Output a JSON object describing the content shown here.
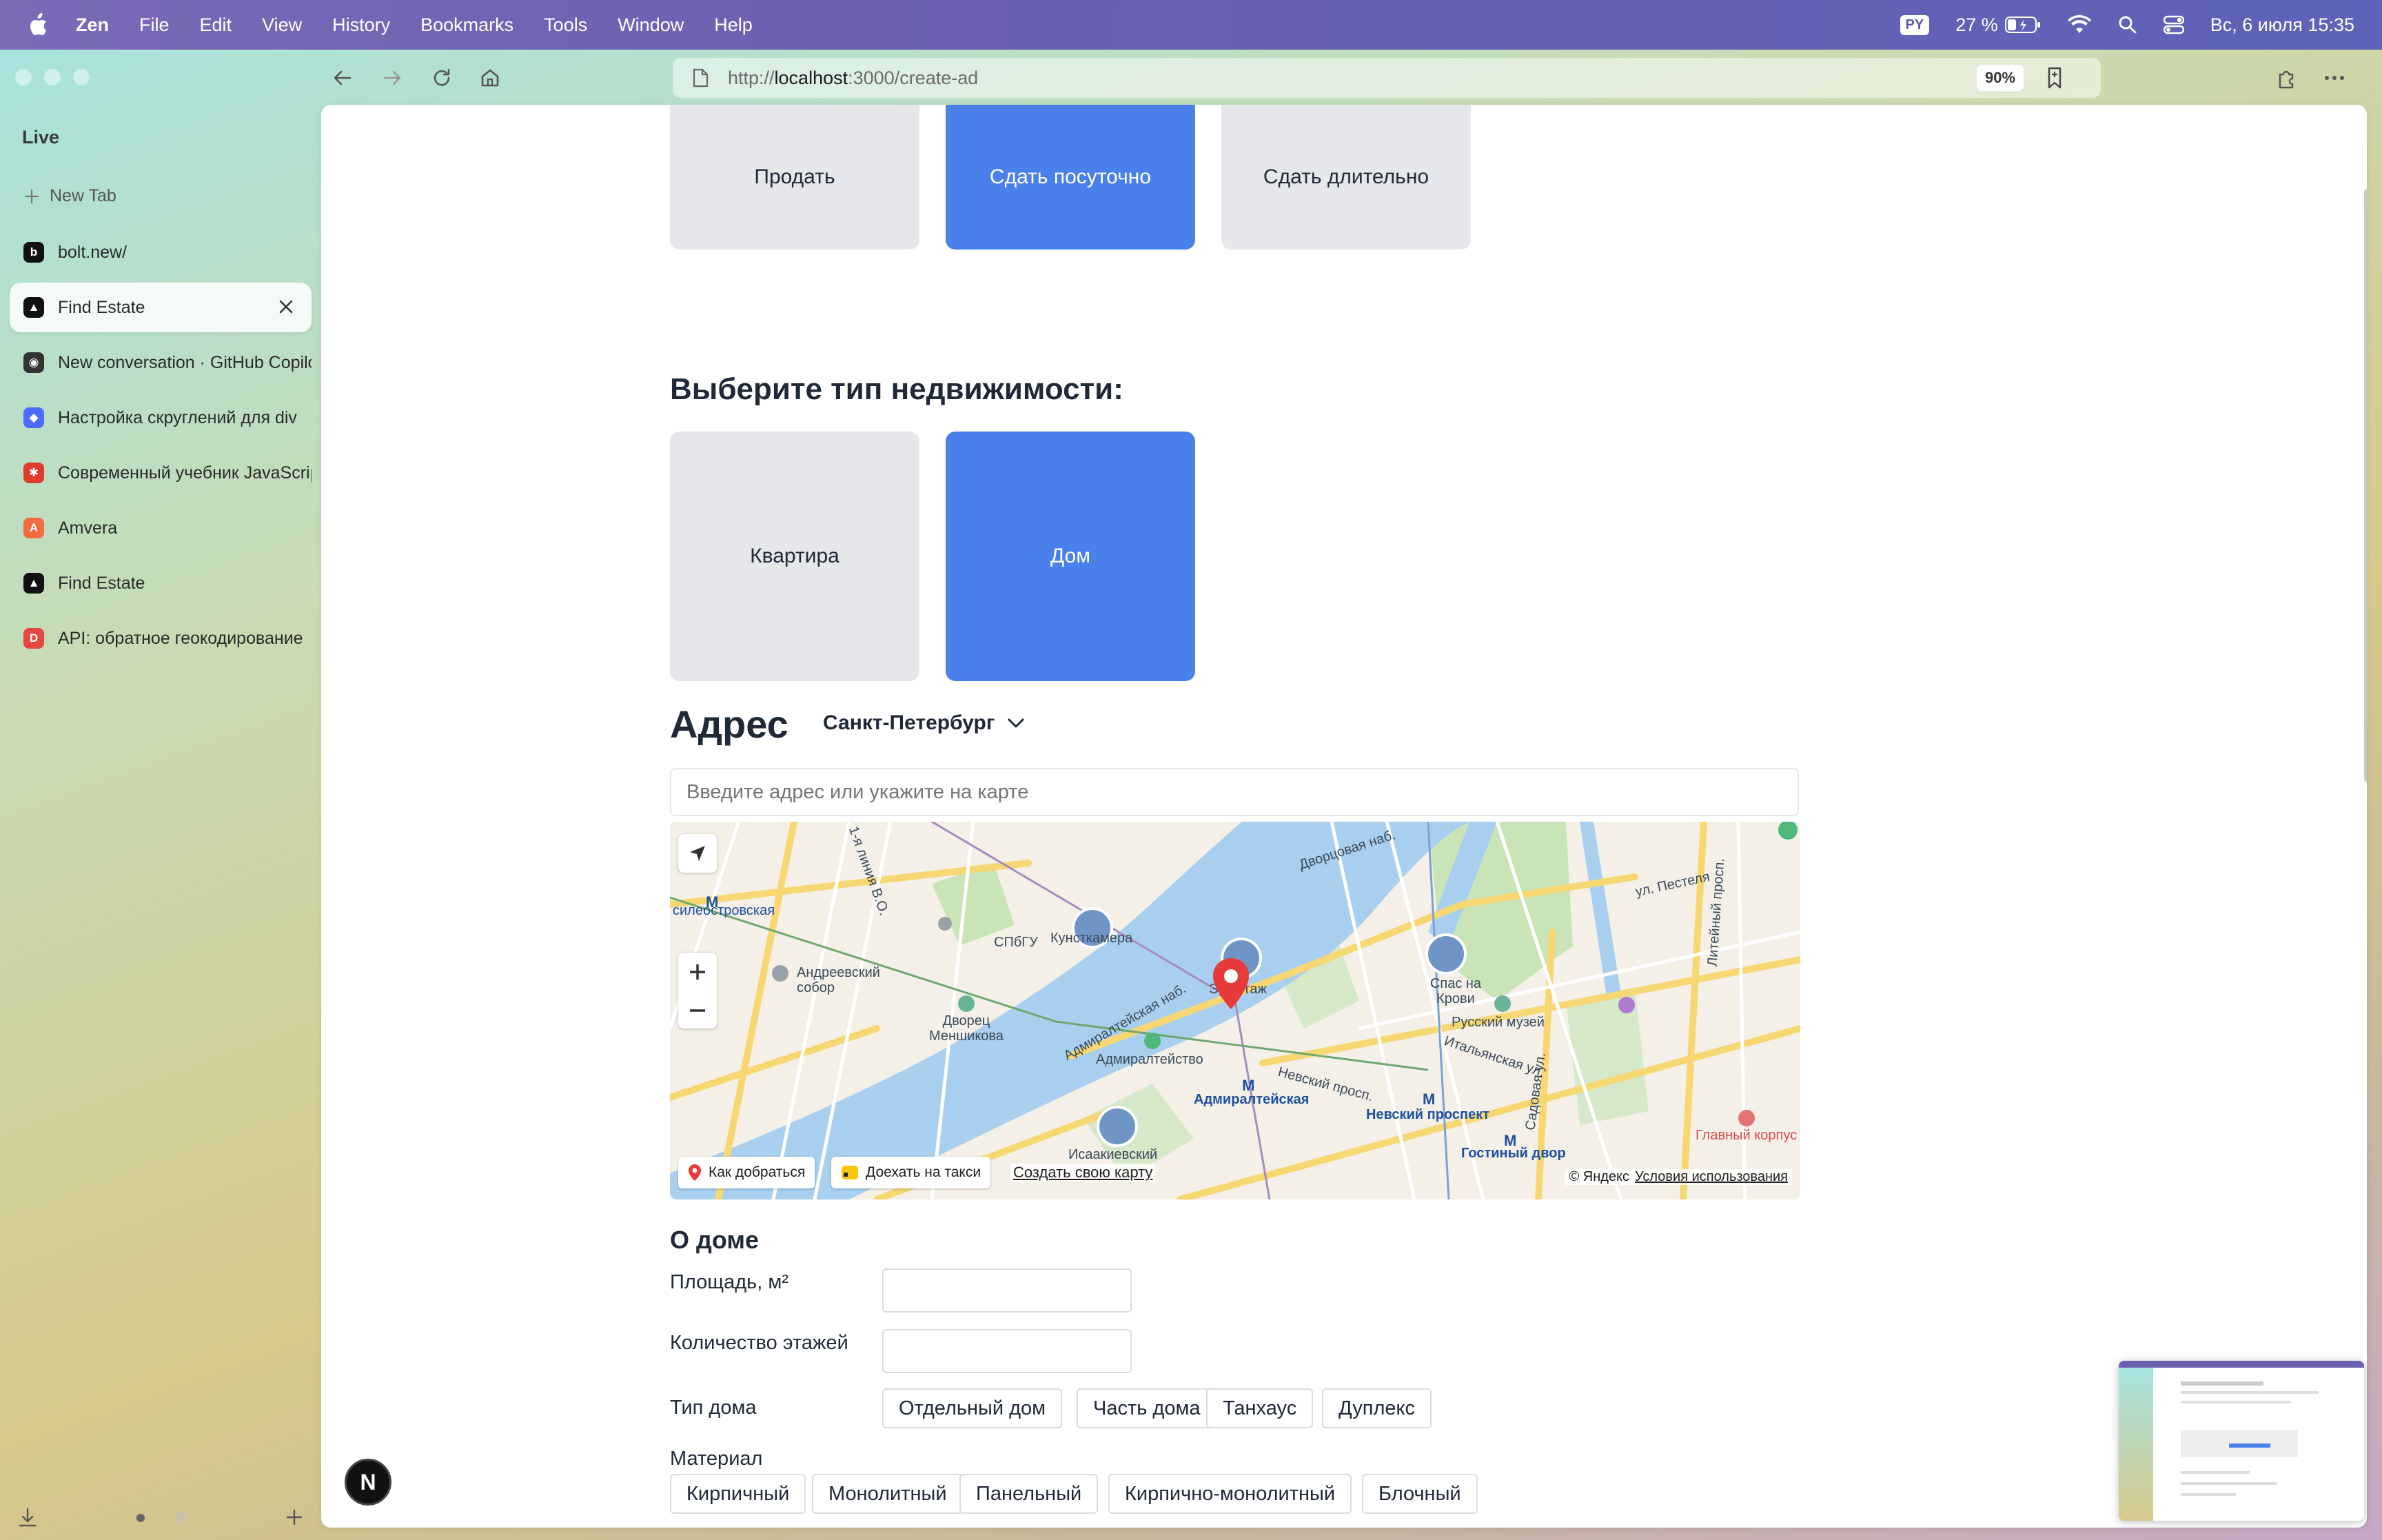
{
  "menubar": {
    "app": "Zen",
    "items": [
      "File",
      "Edit",
      "View",
      "History",
      "Bookmarks",
      "Tools",
      "Window",
      "Help"
    ],
    "lang": "PY",
    "battery": "27 %",
    "datetime": "Вс, 6 июля  15:35"
  },
  "sidebar": {
    "section": "Live",
    "new_tab": "New Tab",
    "tabs": [
      {
        "title": "bolt.new/",
        "icon": "bolt-icon",
        "color": "#111111",
        "glyph": "b"
      },
      {
        "title": "Find Estate",
        "icon": "find-estate-icon",
        "color": "#111111",
        "glyph": "▲",
        "active": true
      },
      {
        "title": "New conversation · GitHub Copilot",
        "icon": "copilot-icon",
        "color": "#333333",
        "glyph": "◉"
      },
      {
        "title": "Настройка скруглений для div",
        "icon": "deepseek-icon",
        "color": "#4d6bfe",
        "glyph": "◆"
      },
      {
        "title": "Современный учебник JavaScript",
        "icon": "javascript-info-icon",
        "color": "#e23b2e",
        "glyph": "✱"
      },
      {
        "title": "Amvera",
        "icon": "amvera-icon",
        "color": "#f26d3d",
        "glyph": "A"
      },
      {
        "title": "Find Estate",
        "icon": "find-estate-icon",
        "color": "#111111",
        "glyph": "▲"
      },
      {
        "title": "API: обратное геокодирование",
        "icon": "dadata-icon",
        "color": "#e5483f",
        "glyph": "D"
      }
    ]
  },
  "toolbar": {
    "url_prefix": "http://",
    "url_host": "localhost",
    "url_rest": ":3000/create-ad",
    "zoom": "90%"
  },
  "deal_types": [
    {
      "label": "Продать",
      "selected": false
    },
    {
      "label": "Сдать посуточно",
      "selected": true
    },
    {
      "label": "Сдать длительно",
      "selected": false
    }
  ],
  "property_heading": "Выберите тип недвижимости:",
  "property_types": [
    {
      "label": "Квартира",
      "selected": false
    },
    {
      "label": "Дом",
      "selected": true
    }
  ],
  "address": {
    "heading": "Адрес",
    "city": "Санкт-Петербург",
    "placeholder": "Введите адрес или укажите на карте"
  },
  "map": {
    "labels": {
      "vasileostrovskaya": "силеостровская",
      "andreevsky": "Андреевский собор",
      "spbgu": "СПбГУ",
      "kunstkamera": "Кунсткамера",
      "ermitazh": "Эрмитаж",
      "spas": "Спас на Крови",
      "russian_museum": "Русский музей",
      "menshikov": "Дворец Меншикова",
      "admiralty": "Адмиралтейство",
      "admiralteyskaya": "Адмиралтейская",
      "nevsky_prospekt": "Невский проспект",
      "gostiny_dvor": "Гостиный двор",
      "isaakievsky": "Исаакиевский",
      "glavny_korpus": "Главный корпус",
      "dvortsovaya": "Дворцовая наб.",
      "nevsky_prosp": "Невский просп.",
      "pestelya": "ул. Пестеля",
      "liteyny": "Литейный просп.",
      "sadovaya": "Садовая ул.",
      "admiralteyskaya_nab": "Адмиралтейская наб.",
      "first_line": "1-я линия В.О.",
      "italyanskaya": "Итальянская ул."
    },
    "buttons": {
      "route": "Как добраться",
      "taxi": "Доехать на такси",
      "create": "Создать свою карту"
    },
    "copyright": "© Яндекс",
    "terms": "Условия использования"
  },
  "house": {
    "heading": "О доме",
    "area_label": "Площадь, м²",
    "floors_label": "Количество этажей",
    "house_type_label": "Тип дома",
    "house_types": [
      "Отдельный дом",
      "Часть дома",
      "Танхаус",
      "Дуплекс"
    ],
    "material_label": "Материал",
    "materials": [
      "Кирпичный",
      "Монолитный",
      "Панельный",
      "Кирпично-монолитный",
      "Блочный"
    ]
  },
  "next_badge": "N",
  "colors": {
    "accent": "#4a80ea",
    "card": "#e5e7eb",
    "water": "#a9cfee",
    "park": "#c5e3b4",
    "road": "#f7d772",
    "marker": "#e83a3a"
  }
}
